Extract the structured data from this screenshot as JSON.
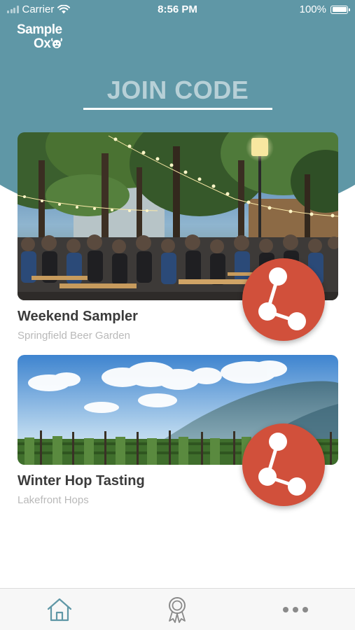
{
  "status_bar": {
    "carrier": "Carrier",
    "time": "8:56 PM",
    "battery": "100%",
    "battery_level": 1.0
  },
  "logo": {
    "line1": "Sample",
    "line2": "Ox"
  },
  "join": {
    "placeholder": "JOIN CODE"
  },
  "sessions": [
    {
      "title": "Weekend Sampler",
      "venue": "Springfield Beer Garden",
      "image": "beer-garden-photo",
      "action_icon": "share-icon"
    },
    {
      "title": "Winter Hop Tasting",
      "venue": "Lakefront Hops",
      "image": "hop-field-photo",
      "action_icon": "share-icon"
    }
  ],
  "tabs": [
    {
      "name": "home",
      "icon": "home-icon",
      "active": true
    },
    {
      "name": "rewards",
      "icon": "award-ribbon-icon",
      "active": false
    },
    {
      "name": "more",
      "icon": "more-dots-icon",
      "active": false
    }
  ],
  "colors": {
    "header": "#5f97a6",
    "share_button": "#d1503b",
    "tab_active": "#5f97a6",
    "tab_inactive": "#8a8a8a",
    "title_text": "#3b3b3b",
    "subtitle_text": "#b9b9b9"
  }
}
